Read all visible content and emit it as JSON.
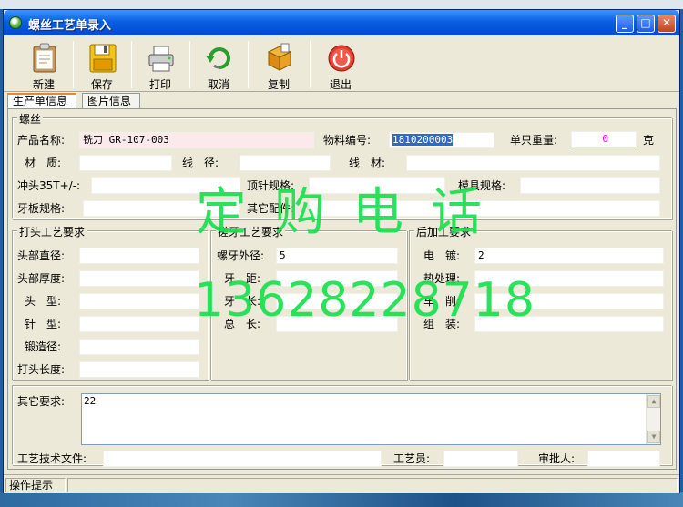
{
  "window": {
    "title": "螺丝工艺单录入",
    "caption_buttons": [
      "minimize-icon",
      "maximize-icon",
      "close-icon"
    ]
  },
  "toolbar": {
    "new_label": "新建",
    "save_label": "保存",
    "print_label": "打印",
    "cancel_label": "取消",
    "copy_label": "复制",
    "exit_label": "退出"
  },
  "tabs": [
    {
      "label": "生产单信息",
      "active": true
    },
    {
      "label": "图片信息",
      "active": false
    }
  ],
  "product": {
    "group_label": "螺丝",
    "name_label": "产品名称:",
    "name_value": "铣刀 GR-107-003",
    "material_no_label": "物料编号:",
    "material_no_value": "1810200003",
    "unit_weight_label": "单只重量:",
    "unit_weight_value": "0",
    "unit_weight_unit": "克",
    "material_label": "材　质:",
    "material_value": "",
    "wire_dia_label": "线　径:",
    "wire_dia_value": "",
    "wire_label": "线　材:",
    "wire_value": "",
    "punch_label": "冲头35T+/-:",
    "punch_value": "",
    "ejector_label": "顶针规格:",
    "ejector_value": "",
    "mold_label": "模具规格:",
    "mold_value": "",
    "thread_plate_label": "牙板规格:",
    "thread_plate_value": "",
    "other_parts_label": "其它配件:",
    "other_parts_value": ""
  },
  "heading": {
    "group_label": "打头工艺要求",
    "head_dia_label": "头部直径:",
    "head_dia_value": "",
    "head_thick_label": "头部厚度:",
    "head_thick_value": "",
    "head_type_label": "头　型:",
    "head_type_value": "",
    "pin_type_label": "针　型:",
    "pin_type_value": "",
    "forge_dia_label": "锻造径:",
    "forge_dia_value": "",
    "head_len_label": "打头长度:",
    "head_len_value": ""
  },
  "threading": {
    "group_label": "搓牙工艺要求",
    "outer_dia_label": "螺牙外径:",
    "outer_dia_value": "5",
    "pitch_label": "牙　距:",
    "pitch_value": "",
    "thread_len_label": "牙　长:",
    "thread_len_value": "",
    "total_len_label": "总　长:",
    "total_len_value": ""
  },
  "post": {
    "group_label": "后加工要求",
    "plating_label": "电　镀:",
    "plating_value": "2",
    "heat_label": "热处理:",
    "heat_value": "",
    "turning_label": "车　削:",
    "turning_value": "",
    "assembly_label": "组　装:",
    "assembly_value": ""
  },
  "other": {
    "requirements_label": "其它要求:",
    "requirements_value": "22",
    "tech_doc_label": "工艺技术文件:",
    "tech_doc_value": "",
    "technician_label": "工艺员:",
    "technician_value": "",
    "approver_label": "审批人:",
    "approver_value": ""
  },
  "status": {
    "hint": "操作提示"
  },
  "watermark": {
    "line1": "定购电话",
    "line2": "13628228718",
    "color": "#19e14f"
  }
}
